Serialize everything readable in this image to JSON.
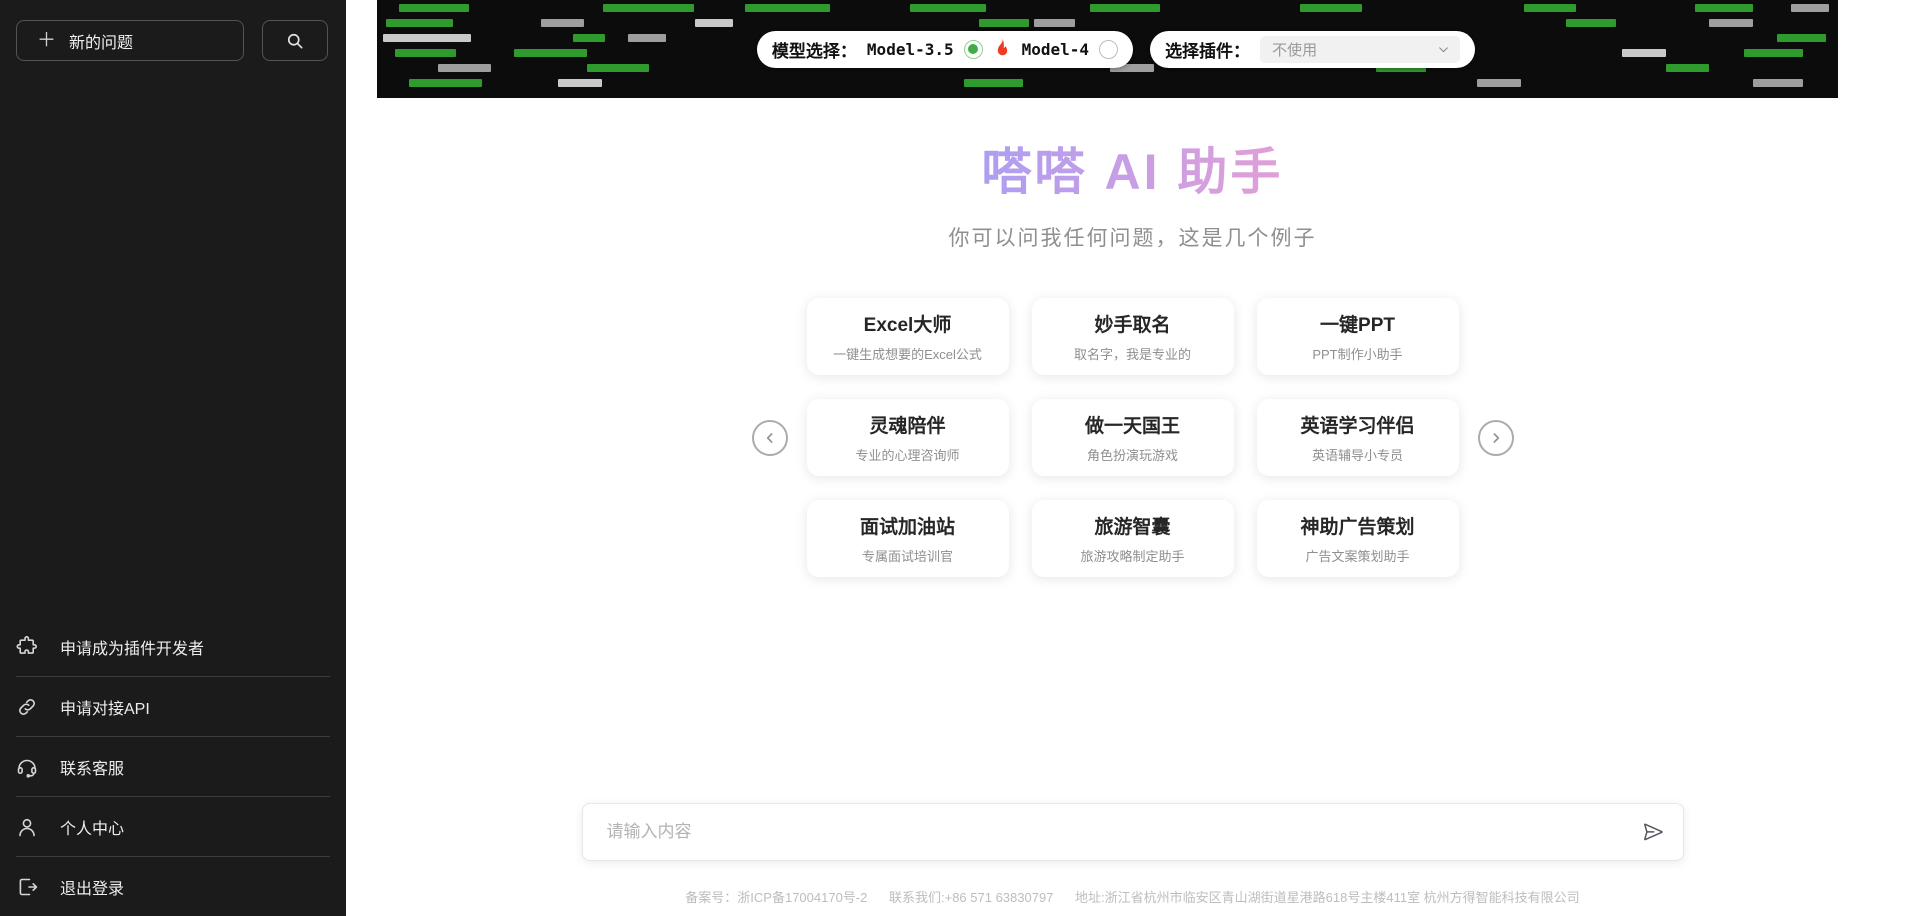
{
  "app": {
    "name": "嗒嗒 AI 助手"
  },
  "sidebar": {
    "new_question_label": "新的问题",
    "menu": [
      {
        "label": "申请成为插件开发者",
        "icon": "puzzle-icon"
      },
      {
        "label": "申请对接API",
        "icon": "link-icon"
      },
      {
        "label": "联系客服",
        "icon": "headset-icon"
      },
      {
        "label": "个人中心",
        "icon": "user-icon"
      },
      {
        "label": "退出登录",
        "icon": "logout-icon"
      }
    ]
  },
  "banner": {
    "model_select_label": "模型选择：",
    "models": [
      {
        "name": "Model-3.5",
        "selected": true
      },
      {
        "name": "Model-4",
        "selected": false
      }
    ],
    "fire_icon": "flame-icon",
    "plugin_select_label": "选择插件：",
    "plugin_selected_value": "不使用",
    "colors": {
      "green": "#2f9b2f",
      "gray": "#9e9e9e",
      "light": "#c9c9c9",
      "bg": "#0c0c0c"
    },
    "bars": [
      [
        0,
        1.5,
        4.8,
        "green"
      ],
      [
        0,
        15.5,
        6.2,
        "green"
      ],
      [
        0,
        25.2,
        5.8,
        "green"
      ],
      [
        0,
        36.5,
        5.2,
        "green"
      ],
      [
        0,
        48.8,
        4.8,
        "green"
      ],
      [
        0,
        63.2,
        4.2,
        "green"
      ],
      [
        0,
        78.5,
        3.6,
        "green"
      ],
      [
        0,
        90.2,
        4.0,
        "green"
      ],
      [
        0,
        96.8,
        2.6,
        "gray"
      ],
      [
        1,
        0.6,
        4.6,
        "green"
      ],
      [
        1,
        11.2,
        3.0,
        "gray"
      ],
      [
        1,
        21.8,
        2.6,
        "light"
      ],
      [
        1,
        41.2,
        3.4,
        "green"
      ],
      [
        1,
        45.0,
        2.8,
        "gray"
      ],
      [
        1,
        81.4,
        3.4,
        "green"
      ],
      [
        1,
        91.2,
        3.0,
        "gray"
      ],
      [
        2,
        0.4,
        6.0,
        "light"
      ],
      [
        2,
        13.4,
        2.2,
        "green"
      ],
      [
        2,
        17.2,
        2.6,
        "gray"
      ],
      [
        2,
        55.4,
        3.0,
        "green"
      ],
      [
        2,
        72.3,
        2.4,
        "gray"
      ],
      [
        2,
        95.8,
        3.4,
        "green"
      ],
      [
        3,
        1.2,
        4.2,
        "green"
      ],
      [
        3,
        9.4,
        5.0,
        "green"
      ],
      [
        3,
        30.2,
        3.0,
        "gray"
      ],
      [
        3,
        60.5,
        2.6,
        "green"
      ],
      [
        3,
        85.2,
        3.0,
        "light"
      ],
      [
        3,
        93.6,
        4.0,
        "green"
      ],
      [
        4,
        4.2,
        3.6,
        "gray"
      ],
      [
        4,
        14.4,
        4.2,
        "green"
      ],
      [
        4,
        50.2,
        3.0,
        "gray"
      ],
      [
        4,
        68.4,
        3.4,
        "green"
      ],
      [
        4,
        88.2,
        3.0,
        "green"
      ],
      [
        5,
        2.2,
        5.0,
        "green"
      ],
      [
        5,
        12.4,
        3.0,
        "light"
      ],
      [
        5,
        40.2,
        4.0,
        "green"
      ],
      [
        5,
        75.3,
        3.0,
        "gray"
      ],
      [
        5,
        94.2,
        3.4,
        "gray"
      ]
    ]
  },
  "hero": {
    "title": "嗒嗒 AI 助手",
    "subtitle": "你可以问我任何问题，这是几个例子",
    "title_gradient": [
      "#6FB1F7",
      "#A89DF5",
      "#F2A0CE",
      "#F6AE63"
    ]
  },
  "examples": [
    {
      "title": "Excel大师",
      "desc": "一键生成想要的Excel公式"
    },
    {
      "title": "妙手取名",
      "desc": "取名字，我是专业的"
    },
    {
      "title": "一键PPT",
      "desc": "PPT制作小助手"
    },
    {
      "title": "灵魂陪伴",
      "desc": "专业的心理咨询师"
    },
    {
      "title": "做一天国王",
      "desc": "角色扮演玩游戏"
    },
    {
      "title": "英语学习伴侣",
      "desc": "英语辅导小专员"
    },
    {
      "title": "面试加油站",
      "desc": "专属面试培训官"
    },
    {
      "title": "旅游智囊",
      "desc": "旅游攻略制定助手"
    },
    {
      "title": "神助广告策划",
      "desc": "广告文案策划助手"
    }
  ],
  "composer": {
    "placeholder": "请输入内容"
  },
  "footer": {
    "beian": "备案号：浙ICP备17004170号-2",
    "contact": "联系我们:+86 571 63830797",
    "address": "地址:浙江省杭州市临安区青山湖街道星港路618号主楼411室 杭州方得智能科技有限公司"
  }
}
